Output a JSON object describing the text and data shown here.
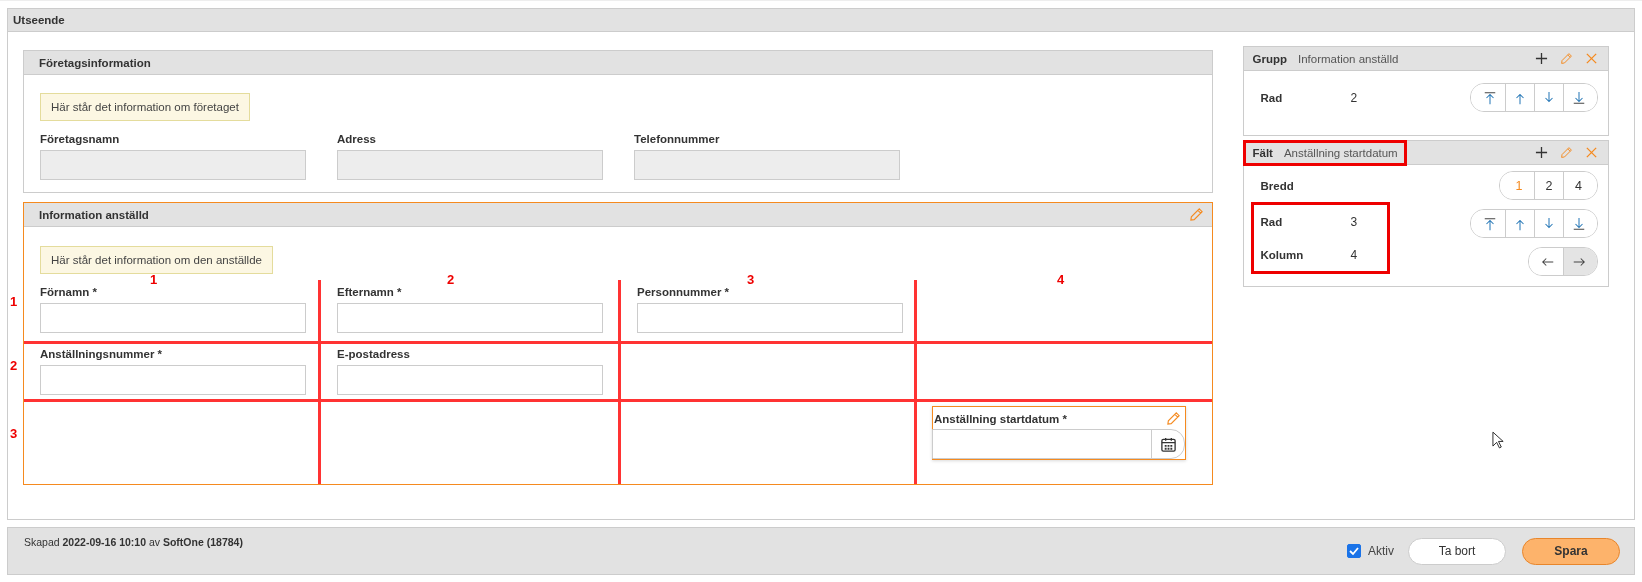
{
  "page_title": "Utseende",
  "company_section": {
    "title": "Företagsinformation",
    "hint": "Här står det information om företaget",
    "fields": [
      {
        "label": "Företagsnamn",
        "disabled": true
      },
      {
        "label": "Adress",
        "disabled": true
      },
      {
        "label": "Telefonnummer",
        "disabled": true
      }
    ]
  },
  "employee_section": {
    "title": "Information anställd",
    "selected": true,
    "hint": "Här står det information om den anställde",
    "column_markers": [
      "1",
      "2",
      "3",
      "4"
    ],
    "rows": [
      {
        "marker": "1",
        "cells": [
          {
            "kind": "text",
            "label": "Förnamn *"
          },
          {
            "kind": "text",
            "label": "Efternamn *"
          },
          {
            "kind": "text",
            "label": "Personnummer *"
          },
          {
            "kind": "empty"
          }
        ]
      },
      {
        "marker": "2",
        "cells": [
          {
            "kind": "text",
            "label": "Anställningsnummer *"
          },
          {
            "kind": "text",
            "label": "E-postadress"
          },
          {
            "kind": "empty"
          },
          {
            "kind": "empty"
          }
        ]
      },
      {
        "marker": "3",
        "cells": [
          {
            "kind": "empty"
          },
          {
            "kind": "empty"
          },
          {
            "kind": "empty"
          },
          {
            "kind": "date",
            "label": "Anställning startdatum *",
            "selected": true
          }
        ]
      }
    ]
  },
  "group_card": {
    "type_label": "Grupp",
    "name": "Information anställd",
    "props": [
      {
        "label": "Rad",
        "value": "2"
      }
    ]
  },
  "field_card": {
    "type_label": "Fält",
    "name": "Anställning startdatum",
    "marked": true,
    "width_label": "Bredd",
    "width_options": [
      {
        "label": "1",
        "selected": true
      },
      {
        "label": "2",
        "selected": false
      },
      {
        "label": "4",
        "selected": false
      }
    ],
    "marked_props": [
      {
        "label": "Rad",
        "value": "3"
      },
      {
        "label": "Kolumn",
        "value": "4"
      }
    ],
    "column_nav": [
      {
        "selected": false
      },
      {
        "selected": true
      }
    ]
  },
  "footer": {
    "created": "Skapad **2022-09-16 10:10** av **SoftOne (18784)**",
    "active": {
      "label": "Aktiv",
      "checked": true
    },
    "buttons": [
      {
        "label": "Ta bort",
        "kind": "secondary"
      },
      {
        "label": "Spara",
        "kind": "primary"
      }
    ]
  }
}
